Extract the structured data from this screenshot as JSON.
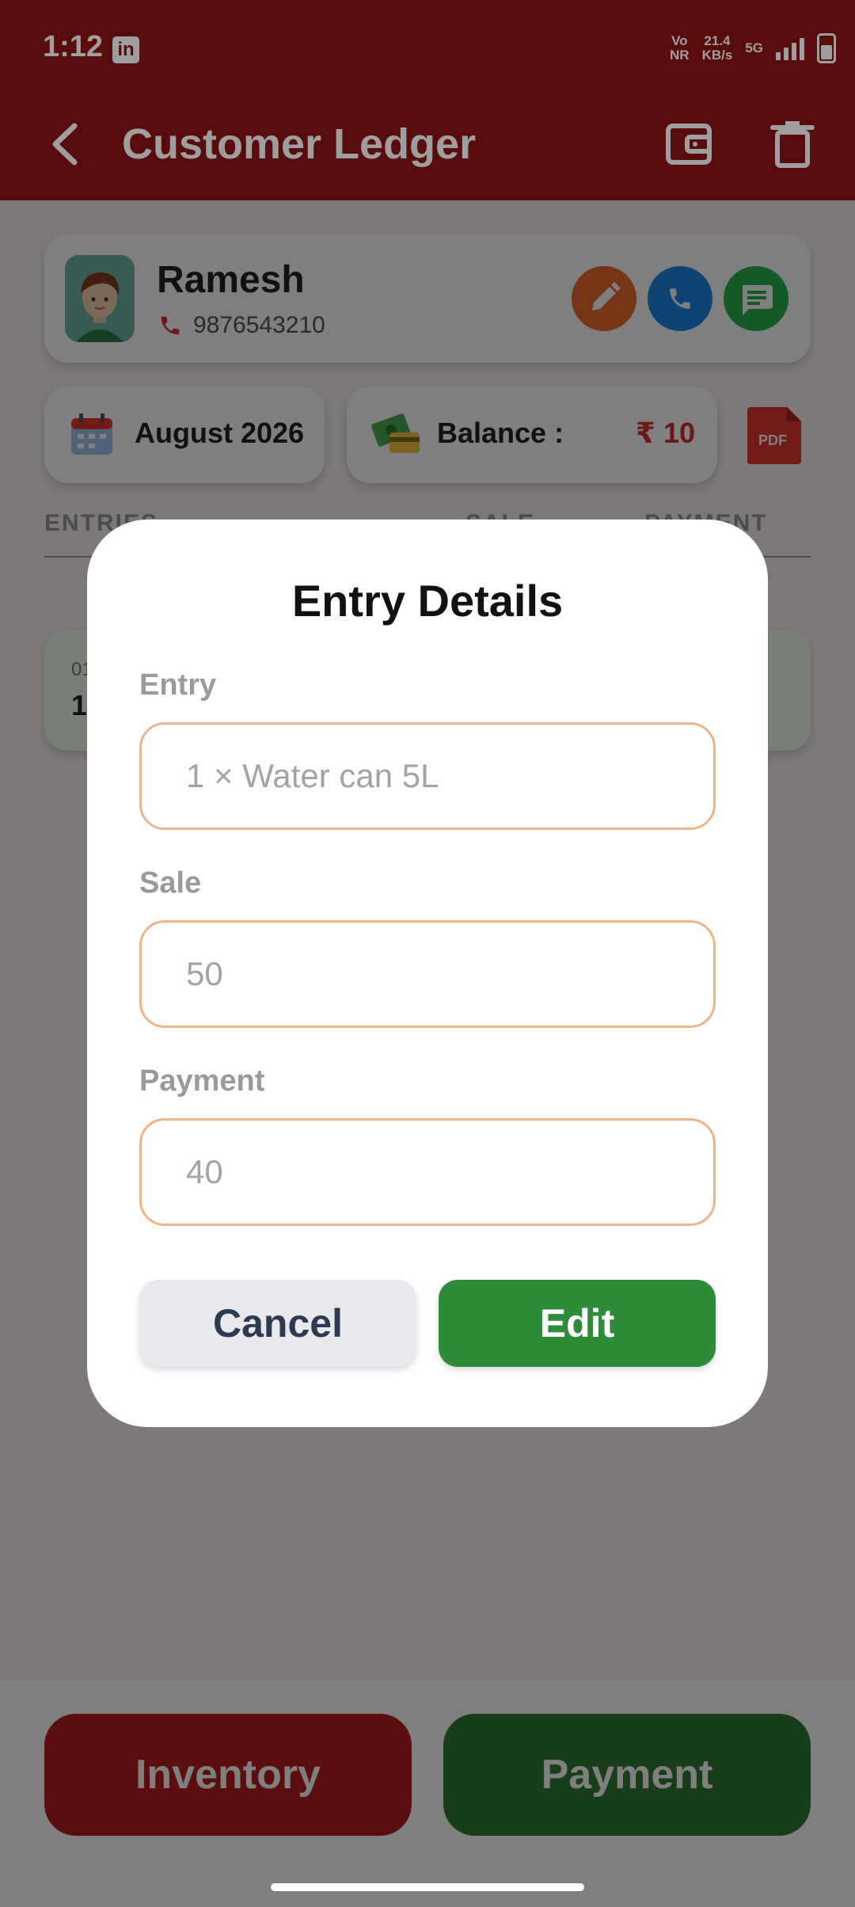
{
  "status_bar": {
    "time": "1:12",
    "app_icon": "in",
    "network_1": "Vo\nNR",
    "speed": "21.4\nKB/s",
    "network_2": "5G"
  },
  "app_bar": {
    "title": "Customer Ledger",
    "color": "#8e1414"
  },
  "customer": {
    "name": "Ramesh",
    "phone": "9876543210"
  },
  "summary": {
    "month": "August 2026",
    "balance_label": "Balance :",
    "balance_value": "₹ 10",
    "pdf_label": "PDF"
  },
  "table": {
    "headers": [
      "ENTRIES",
      "SALE",
      "PAYMENT"
    ],
    "rows": [
      {
        "date": "01",
        "qty": "1"
      }
    ]
  },
  "bottom": {
    "inventory_label": "Inventory",
    "payment_label": "Payment"
  },
  "dialog": {
    "title": "Entry Details",
    "entry_label": "Entry",
    "entry_value": "1 × Water can 5L",
    "sale_label": "Sale",
    "sale_value": "50",
    "payment_label": "Payment",
    "payment_value": "40",
    "cancel_label": "Cancel",
    "edit_label": "Edit"
  },
  "colors": {
    "primary": "#8e1414",
    "accent_green": "#2e8b3a",
    "field_border": "#efb487",
    "balance_red": "#d32f2f"
  }
}
